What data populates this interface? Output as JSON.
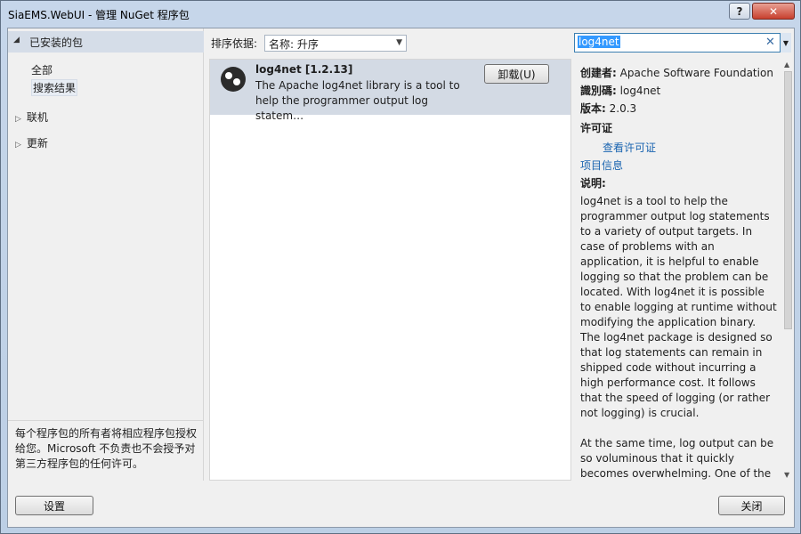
{
  "window": {
    "title": "SiaEMS.WebUI - 管理 NuGet 程序包",
    "help_label": "?",
    "close_label": "✕"
  },
  "nav": {
    "installed_label": "已安装的包",
    "sub_items": [
      {
        "label": "全部"
      },
      {
        "label": "搜索结果"
      }
    ],
    "online_label": "联机",
    "updates_label": "更新",
    "note": "每个程序包的所有者将相应程序包授权给您。Microsoft 不负责也不会授予对第三方程序包的任何许可。"
  },
  "sort": {
    "label": "排序依据:",
    "value": "名称: 升序"
  },
  "search": {
    "value": "log4net"
  },
  "package": {
    "name": "log4net [1.2.13]",
    "desc_line1": "The Apache log4net library is a tool to",
    "desc_line2": "help the programmer output log statem…",
    "uninstall_label": "卸载(U)"
  },
  "details": {
    "creator_label": "创建者:",
    "creator_value": "Apache Software Foundation",
    "id_label": "識別碼:",
    "id_value": "log4net",
    "version_label": "版本:",
    "version_value": "2.0.3",
    "license_label": "许可证",
    "view_license": "查看许可证",
    "project_info": "项目信息",
    "desc_label": "说明:",
    "desc_para1": "log4net is a tool to help the programmer output log statements to a variety of output targets. In case of problems with an application, it is helpful to enable logging so that the problem can be located. With log4net it is possible to enable logging at runtime without modifying the application binary. The log4net package is designed so that log statements can remain in shipped code without incurring a high performance cost. It follows that the speed of logging (or rather not logging) is crucial.",
    "desc_para2": "At the same time, log output can be so voluminous that it quickly becomes overwhelming. One of the"
  },
  "footer": {
    "settings_label": "设置",
    "close_label": "关闭"
  }
}
